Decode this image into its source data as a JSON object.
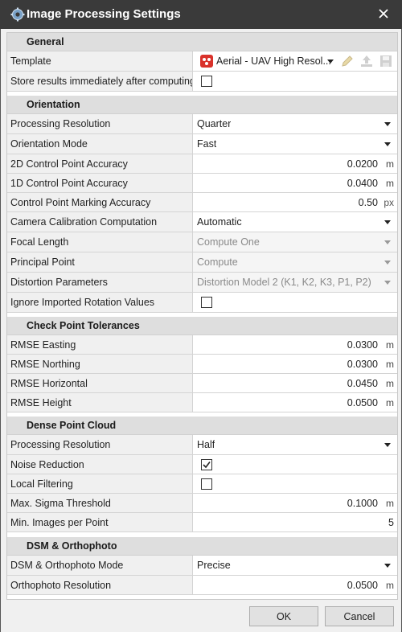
{
  "window": {
    "title": "Image Processing Settings"
  },
  "sections": {
    "general": "General",
    "orientation": "Orientation",
    "check": "Check Point Tolerances",
    "dense": "Dense Point Cloud",
    "dsm": "DSM & Orthophoto"
  },
  "general": {
    "template_label": "Template",
    "template_value": "Aerial - UAV High Resol...",
    "store_label": "Store results immediately after computing",
    "store_checked": false
  },
  "orientation": {
    "proc_res_label": "Processing Resolution",
    "proc_res_value": "Quarter",
    "mode_label": "Orientation Mode",
    "mode_value": "Fast",
    "acc2d_label": "2D Control Point Accuracy",
    "acc2d_value": "0.0200",
    "acc2d_unit": "m",
    "acc1d_label": "1D Control Point Accuracy",
    "acc1d_value": "0.0400",
    "acc1d_unit": "m",
    "marking_label": "Control Point Marking Accuracy",
    "marking_value": "0.50",
    "marking_unit": "px",
    "calib_label": "Camera Calibration Computation",
    "calib_value": "Automatic",
    "focal_label": "Focal Length",
    "focal_value": "Compute One",
    "principal_label": "Principal Point",
    "principal_value": "Compute",
    "distortion_label": "Distortion Parameters",
    "distortion_value": "Distortion Model 2 (K1, K2, K3, P1, P2)",
    "ignore_label": "Ignore Imported Rotation Values",
    "ignore_checked": false
  },
  "check": {
    "easting_label": "RMSE Easting",
    "easting_value": "0.0300",
    "easting_unit": "m",
    "northing_label": "RMSE Northing",
    "northing_value": "0.0300",
    "northing_unit": "m",
    "horizontal_label": "RMSE Horizontal",
    "horizontal_value": "0.0450",
    "horizontal_unit": "m",
    "height_label": "RMSE Height",
    "height_value": "0.0500",
    "height_unit": "m"
  },
  "dense": {
    "proc_res_label": "Processing Resolution",
    "proc_res_value": "Half",
    "noise_label": "Noise Reduction",
    "noise_checked": true,
    "local_label": "Local Filtering",
    "local_checked": false,
    "sigma_label": "Max. Sigma Threshold",
    "sigma_value": "0.1000",
    "sigma_unit": "m",
    "min_images_label": "Min. Images per Point",
    "min_images_value": "5"
  },
  "dsm": {
    "mode_label": "DSM & Orthophoto Mode",
    "mode_value": "Precise",
    "ortho_res_label": "Orthophoto Resolution",
    "ortho_res_value": "0.0500",
    "ortho_res_unit": "m"
  },
  "buttons": {
    "ok": "OK",
    "cancel": "Cancel"
  },
  "colors": {
    "title_bar": "#3a3a3a",
    "template_icon": "#d9322b",
    "section_bg": "#dedede"
  }
}
